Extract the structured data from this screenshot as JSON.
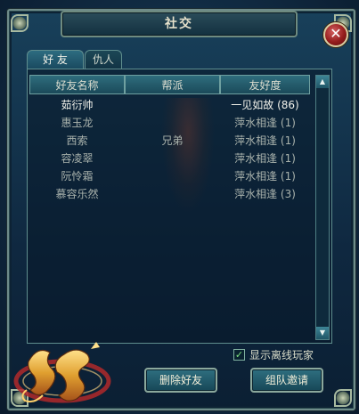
{
  "window": {
    "title": "社交"
  },
  "tabs": [
    {
      "label": "好 友",
      "active": true
    },
    {
      "label": "仇人",
      "active": false
    }
  ],
  "list": {
    "columns": [
      "好友名称",
      "帮派",
      "友好度"
    ],
    "rows": [
      {
        "name": "茹衍帅",
        "guild": "",
        "friendship": "一见如故 (86)",
        "selected": true
      },
      {
        "name": "惠玉龙",
        "guild": "",
        "friendship": "萍水相逢 (1)",
        "selected": false
      },
      {
        "name": "西索",
        "guild": "兄弟",
        "friendship": "萍水相逢 (1)",
        "selected": false
      },
      {
        "name": "容凌翠",
        "guild": "",
        "friendship": "萍水相逢 (1)",
        "selected": false
      },
      {
        "name": "阮怜霜",
        "guild": "",
        "friendship": "萍水相逢 (1)",
        "selected": false
      },
      {
        "name": "慕容乐然",
        "guild": "",
        "friendship": "萍水相逢 (3)",
        "selected": false
      }
    ]
  },
  "options": {
    "show_offline_label": "显示离线玩家",
    "show_offline_checked": true
  },
  "buttons": {
    "delete_friend": "删除好友",
    "invite_team": "组队邀请"
  },
  "icons": {
    "close": "close-icon",
    "scroll_up": "arrow-up-icon",
    "scroll_down": "arrow-down-icon",
    "check": "checkmark-icon"
  },
  "colors": {
    "frame": "#6f8c8a",
    "panel_bg": "#0f2840",
    "text_selected": "#f1f1ea",
    "text_normal": "#a9b2ac"
  }
}
